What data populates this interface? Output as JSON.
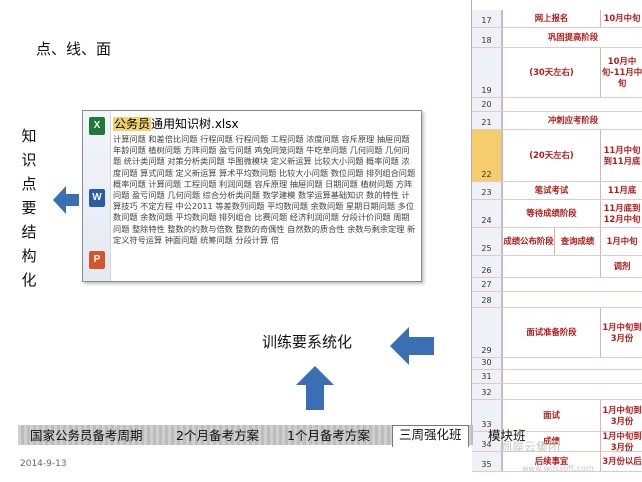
{
  "heading": "点、线、面",
  "vertical_label": "知识点要结构化",
  "train_label": "训练要系统化",
  "date": "2014-9-13",
  "tooltip": {
    "title_highlight": "公务员",
    "title_rest": "通用知识树.xlsx",
    "body": "计算问题 和差倍比问题 行程问题 行程问题 工程问题 浓度问题 容斥原理 抽屉问题 年龄问题 植树问题 方阵问题 盈亏问题 鸡兔同笼问题 牛吃草问题 几何问题 几何问题 统计类问题 对策分析类问题 华图微模块 定义新运算 比较大小问题 概率问题 浓度问题 算式问题 定义新运算 算术平均数问题 比较大小问题 数位问题 排列组合问题 概率问题 计算问题 工程问题 利润问题 容斥原理 抽屉问题 日期问题 植树问题 方阵问题 盈亏问题 几何问题 综合分析类问题 数学建模 数学运算基础知识 数的特性 计算技巧 不定方程 中公2011 等差数列问题 平均数问题 余数问题 星期日期问题 多位数问题 余数问题 平均数问题 排列组合 比赛问题 经济利润问题 分段计价问题 周期问题 整除特性 整数的约数与倍数 整数的奇偶性 自然数的质合性 余数与剩余定理 新定义符号运算 钟面问题 统筹问题 分段计算 倍",
    "file_icons": [
      "X",
      "W",
      "P"
    ]
  },
  "sheet": {
    "rows": [
      {
        "num": "17",
        "cells": [
          "网上报名",
          "10月中旬"
        ]
      },
      {
        "num": "18",
        "cells": [
          "巩固提高阶段"
        ]
      },
      {
        "num": "19",
        "cells": [
          "(30天左右)",
          "10月中旬-11月中旬"
        ]
      },
      {
        "num": "20",
        "cells": [
          ""
        ]
      },
      {
        "num": "21",
        "cells": [
          "冲刺应考阶段"
        ]
      },
      {
        "num": "22",
        "cells": [
          "(20天左右)",
          "11月中旬到11月底"
        ]
      },
      {
        "num": "23",
        "cells": [
          "笔试考试",
          "11月底"
        ]
      },
      {
        "num": "24",
        "cells": [
          "等待成绩阶段",
          "11月底到12月中旬"
        ]
      },
      {
        "num": "25",
        "cells": [
          "成绩公布阶段",
          "查询成绩",
          "1月中旬"
        ]
      },
      {
        "num": "26",
        "cells": [
          "",
          "调剂"
        ]
      },
      {
        "num": "27",
        "cells": [
          ""
        ]
      },
      {
        "num": "28",
        "cells": [
          ""
        ]
      },
      {
        "num": "29",
        "cells": [
          "面试准备阶段",
          "1月中旬到3月份"
        ]
      },
      {
        "num": "30",
        "cells": [
          ""
        ]
      },
      {
        "num": "31",
        "cells": [
          ""
        ]
      },
      {
        "num": "32",
        "cells": [
          ""
        ]
      },
      {
        "num": "33",
        "cells": [
          "面试",
          "1月中旬到3月份"
        ]
      },
      {
        "num": "34",
        "cells": [
          "成绩",
          "1月中旬到3月份"
        ]
      },
      {
        "num": "35",
        "cells": [
          "后续事宜",
          "3月份以后"
        ]
      }
    ]
  },
  "tabs": [
    "国家公务员备考周期",
    "2个月备考方案",
    "1个月备考方案",
    "三周强化班",
    "模块班"
  ],
  "watermark": "圆犀云集团",
  "watermark_url": "www.wdssoft.com",
  "colors": {
    "accent_blue": "#3a6fb4",
    "sheet_red": "#b11c1c",
    "selected_row": "#f5cd6a"
  }
}
